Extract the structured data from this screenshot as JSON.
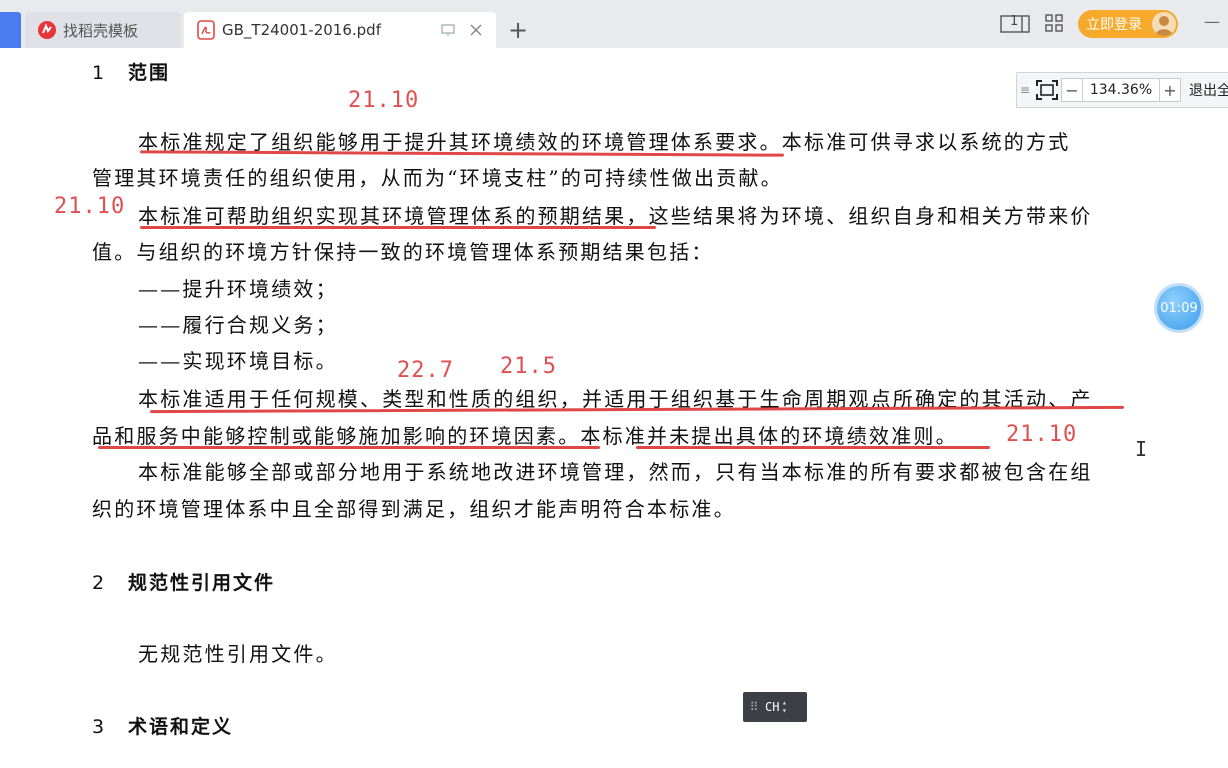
{
  "tabs": [
    {
      "label": "找稻壳模板",
      "icon": "docer-logo-icon",
      "active": false
    },
    {
      "label": "GB_T24001-2016.pdf",
      "icon": "pdf-icon",
      "active": true
    }
  ],
  "header": {
    "new_tab": "+",
    "login_label": "立即登录",
    "page_indicator": "1"
  },
  "zoom": {
    "value": "134.36%",
    "minus": "−",
    "plus": "+",
    "exit_label": "退出全"
  },
  "timer": "01:09",
  "ime": {
    "label": "CH"
  },
  "document": {
    "section1": {
      "num": "1",
      "title": "范围"
    },
    "lines": [
      "本标准规定了组织能够用于提升其环境绩效的环境管理体系要求。本标准可供寻求以系统的方式",
      "管理其环境责任的组织使用，从而为“环境支柱”的可持续性做出贡献。",
      "本标准可帮助组织实现其环境管理体系的预期结果，这些结果将为环境、组织自身和相关方带来价",
      "值。与组织的环境方针保持一致的环境管理体系预期结果包括：",
      "——提升环境绩效；",
      "——履行合规义务；",
      "——实现环境目标。",
      "本标准适用于任何规模、类型和性质的组织，并适用于组织基于生命周期观点所确定的其活动、产",
      "品和服务中能够控制或能够施加影响的环境因素。本标准并未提出具体的环境绩效准则。",
      "本标准能够全部或部分地用于系统地改进环境管理，然而，只有当本标准的所有要求都被包含在组",
      "织的环境管理体系中且全部得到满足，组织才能声明符合本标准。"
    ],
    "section2": {
      "num": "2",
      "title": "规范性引用文件"
    },
    "section2_body": "无规范性引用文件。",
    "section3": {
      "num": "3",
      "title": "术语和定义"
    }
  },
  "annotations": [
    "21.10",
    "21.10",
    "22.7",
    "21.5",
    "21.10"
  ],
  "colors": {
    "annotation": "#e05050",
    "active_tab": "#ffffff",
    "login": "#f7a92b"
  }
}
